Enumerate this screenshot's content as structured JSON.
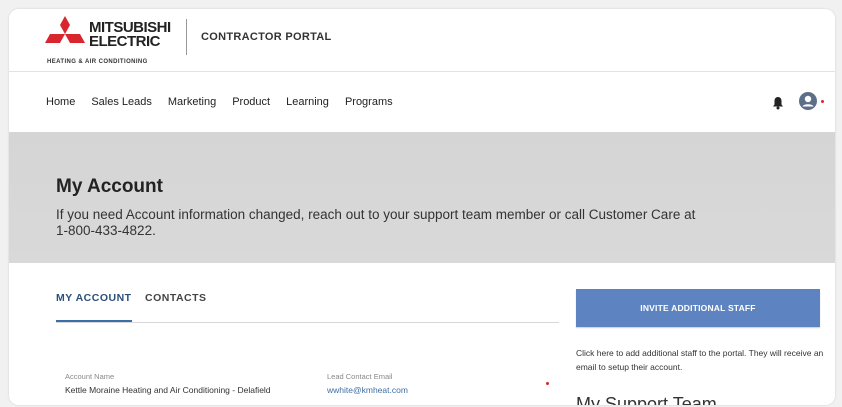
{
  "header": {
    "brand_line1": "MITSUBISHI",
    "brand_line2": "ELECTRIC",
    "brand_tagline": "HEATING & AIR CONDITIONING",
    "portal_title": "CONTRACTOR PORTAL",
    "logo_color": "#d9262e"
  },
  "nav": {
    "items": [
      {
        "label": "Home"
      },
      {
        "label": "Sales Leads"
      },
      {
        "label": "Marketing"
      },
      {
        "label": "Product"
      },
      {
        "label": "Learning"
      },
      {
        "label": "Programs"
      }
    ],
    "bell_icon": "bell-icon",
    "avatar_icon": "user-avatar-icon"
  },
  "hero": {
    "title": "My Account",
    "text": "If you need Account information changed, reach out to your support team member or call Customer Care at 1-800-433-4822."
  },
  "tabs": {
    "account": "MY ACCOUNT",
    "contacts": "CONTACTS"
  },
  "fields": {
    "account_name_label": "Account Name",
    "account_name_value": "Kettle Moraine Heating and Air Conditioning - Delafield",
    "lead_email_label": "Lead Contact Email",
    "lead_email_value": "wwhite@kmheat.com"
  },
  "sidebar": {
    "invite_button": "INVITE ADDITIONAL STAFF",
    "invite_description": "Click here to add additional staff to the portal. They will receive an email to setup their account.",
    "support_title": "My Support Team",
    "accent_color": "#5d84c0"
  }
}
